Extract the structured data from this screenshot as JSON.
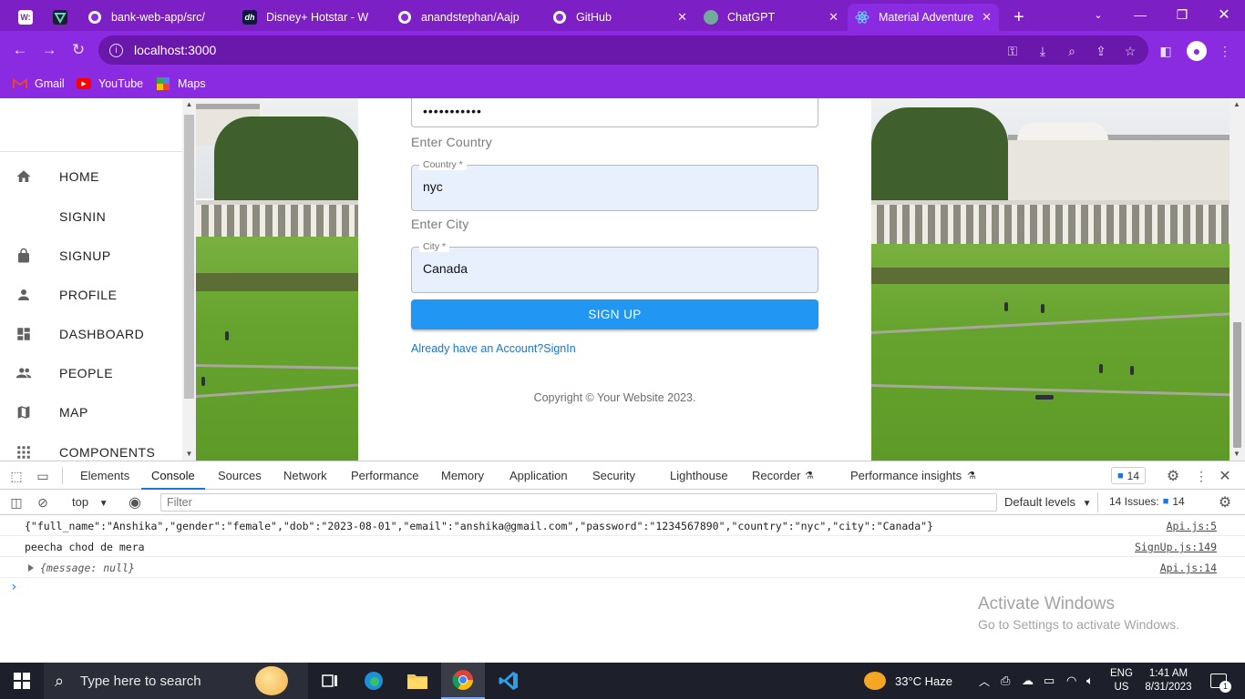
{
  "browser": {
    "tabs": [
      {
        "title": "",
        "icon": "w-icon",
        "color": "#ffffff"
      },
      {
        "title": "",
        "icon": "vercel-icon",
        "color": "#1e1e2a"
      },
      {
        "title": "bank-web-app/src/",
        "icon": "github-icon"
      },
      {
        "title": "Disney+ Hotstar - W",
        "icon": "hotstar-icon"
      },
      {
        "title": "anandstephan/Aajp",
        "icon": "github-icon"
      },
      {
        "title": "GitHub",
        "icon": "github-icon"
      },
      {
        "title": "ChatGPT",
        "icon": "chatgpt-icon"
      },
      {
        "title": "Material Adventure",
        "icon": "react-icon"
      }
    ],
    "url": "localhost:3000",
    "bookmarks": [
      {
        "label": "Gmail",
        "icon": "gmail-icon"
      },
      {
        "label": "YouTube",
        "icon": "youtube-icon"
      },
      {
        "label": "Maps",
        "icon": "maps-icon"
      }
    ],
    "accent": "#8a2be2"
  },
  "sidebar": {
    "items": [
      {
        "label": "HOME",
        "icon": "home-icon"
      },
      {
        "label": "SIGNIN",
        "icon": ""
      },
      {
        "label": "SIGNUP",
        "icon": "lock-icon"
      },
      {
        "label": "PROFILE",
        "icon": "person-icon"
      },
      {
        "label": "DASHBOARD",
        "icon": "dashboard-icon"
      },
      {
        "label": "PEOPLE",
        "icon": "people-icon"
      },
      {
        "label": "MAP",
        "icon": "map-icon"
      },
      {
        "label": "COMPONENTS",
        "icon": "apps-icon"
      }
    ]
  },
  "form": {
    "password_mask": "•••••••••••",
    "country_prompt": "Enter Country",
    "country_label": "Country *",
    "country_value": "nyc",
    "city_prompt": "Enter City",
    "city_label": "City *",
    "city_value": "Canada",
    "submit_label": "SIGN UP",
    "signin_link": "Already have an Account?SignIn",
    "copyright": "Copyright © Your Website 2023."
  },
  "devtools": {
    "tabs": [
      "Elements",
      "Console",
      "Sources",
      "Network",
      "Performance",
      "Memory",
      "Application",
      "Security",
      "Lighthouse",
      "Recorder",
      "Performance insights"
    ],
    "active_tab": "Console",
    "message_count": "14",
    "context": "top",
    "filter_placeholder": "Filter",
    "levels": "Default levels",
    "issues": "14 Issues:",
    "issues_count": "14",
    "logs": [
      {
        "text": "{\"full_name\":\"Anshika\",\"gender\":\"female\",\"dob\":\"2023-08-01\",\"email\":\"anshika@gmail.com\",\"password\":\"1234567890\",\"country\":\"nyc\",\"city\":\"Canada\"}",
        "source": "Api.js:5"
      },
      {
        "text": "peecha chod de mera",
        "source": "SignUp.js:149"
      },
      {
        "text": "{message: null}",
        "source": "Api.js:14"
      }
    ],
    "watermark_title": "Activate Windows",
    "watermark_sub": "Go to Settings to activate Windows."
  },
  "taskbar": {
    "search_placeholder": "Type here to search",
    "weather": "33°C  Haze",
    "lang_1": "ENG",
    "lang_2": "US",
    "time": "1:41 AM",
    "date": "8/31/2023",
    "notifications": "1"
  }
}
